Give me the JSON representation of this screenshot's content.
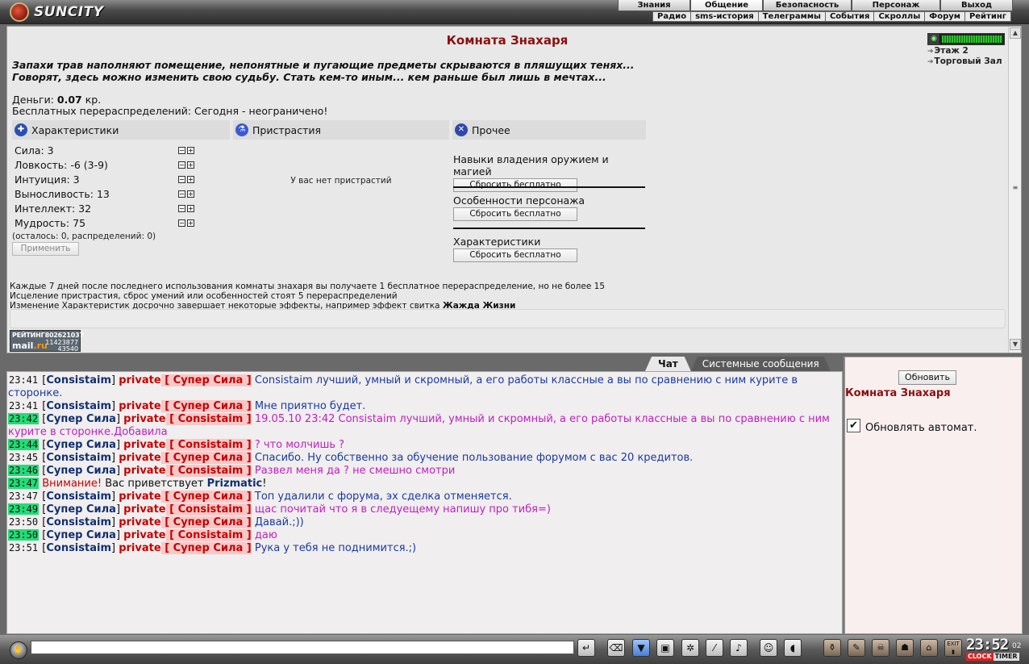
{
  "logo": {
    "text": "SUNCITY"
  },
  "nav_main": [
    "Знания",
    "Общение",
    "Безопасность",
    "Персонаж",
    "Выход"
  ],
  "nav_sub": [
    "Радио",
    "sms-история",
    "Телеграммы",
    "События",
    "Скроллы",
    "Форум",
    "Рейтинг"
  ],
  "room": {
    "title": "Комната Знахаря",
    "description_1": "Запахи трав наполняют помещение, непонятные и пугающие предметы скрываются в пляшущих тенях...",
    "description_2": "Говорят, здесь можно изменить свою судьбу. Стать кем-то иным... кем раньше был лишь в мечтах...",
    "money_label": "Деньги:",
    "money_value": "0.07",
    "money_unit": "кр.",
    "free_redist": "Бесплатных перераспределений: Сегодня - неограничено!",
    "location": {
      "links": [
        "Этаж 2",
        "Торговый Зал"
      ]
    },
    "stats_header": "Характеристики",
    "addict_header": "Пристрастия",
    "other_header": "Прочее",
    "stats": [
      "Сила: 3",
      "Ловкость: -6 (3-9)",
      "Интуиция: 3",
      "Выносливость: 13",
      "Интеллект: 32",
      "Мудрость: 75"
    ],
    "remaining": "(осталось: 0, распределений: 0)",
    "apply_label": "Применить",
    "no_addict": "У вас нет пристрастий",
    "other_blocks": [
      {
        "title": "Навыки владения оружием и магией",
        "button": "Сбросить бесплатно"
      },
      {
        "title": "Особенности персонажа",
        "button": "Сбросить бесплатно"
      },
      {
        "title": "Характеристики",
        "button": "Сбросить бесплатно"
      }
    ],
    "note_1": "Каждые 7 дней после последнего использования комнаты знахаря вы получаете 1 бесплатное перераспределение, но не более 15",
    "note_2": "Исцеление пристрастия, сброс умений или особенностей стоят 5 перераспределений",
    "note_3_prefix": "Изменение Характеристик досрочно завершает некоторые эффекты, например эффект свитка",
    "note_3_bold": "Жажда Жизни",
    "counter": {
      "label": "РЕЙТИНГ",
      "n1": "802621037",
      "n2": "11423877",
      "n3": "43540",
      "brand_a": "mail",
      "brand_b": ".ru"
    }
  },
  "chat": {
    "tabs": [
      "Чат",
      "Системные сообщения"
    ],
    "messages": [
      {
        "time": "23:41",
        "nick": "Consistaim",
        "priv": "Супер Сила",
        "text": "Consistaim лучший, умный и скромный, а его работы классные а вы по сравнению с ним курите в",
        "text2": "сторонке."
      },
      {
        "time": "23:41",
        "nick": "Consistaim",
        "priv": "Супер Сила",
        "text": "Мне приятно будет."
      },
      {
        "time": "23:42",
        "nick": "Супер Сила",
        "priv": "Consistaim",
        "text": "19.05.10 23:42 Consistaim лучший, умный и скромный, а его работы классные а вы по сравнению с ним",
        "text2": "курите в сторонке.Добавила"
      },
      {
        "time": "23:44",
        "nick": "Супер Сила",
        "priv": "Consistaim",
        "text": "? что молчишь ?"
      },
      {
        "time": "23:45",
        "nick": "Consistaim",
        "priv": "Супер Сила",
        "text": "Спасибо. Ну собственно за обучение пользование форумом с вас 20 кредитов."
      },
      {
        "time": "23:46",
        "nick": "Супер Сила",
        "priv": "Consistaim",
        "text": "Развел меня да ? не смешно смотри"
      },
      {
        "time": "23:47",
        "warn": "Внимание!",
        "sys_text": "Вас приветствует",
        "sys_nick": "Prizmatic",
        "sys_end": "!"
      },
      {
        "time": "23:47",
        "nick": "Consistaim",
        "priv": "Супер Сила",
        "text": "Топ удалили с форума, эх сделка отменяется."
      },
      {
        "time": "23:49",
        "nick": "Супер Сила",
        "priv": "Consistaim",
        "text": "щас почитай что я в следуещему напишу про тибя=)"
      },
      {
        "time": "23:50",
        "nick": "Consistaim",
        "priv": "Супер Сила",
        "text": "Давай.;))"
      },
      {
        "time": "23:50",
        "nick": "Супер Сила",
        "priv": "Consistaim",
        "text": "даю"
      },
      {
        "time": "23:51",
        "nick": "Consistaim",
        "priv": "Супер Сила",
        "text": "Рука у тебя не поднимится.;)"
      }
    ],
    "private_word": "private"
  },
  "side": {
    "refresh_label": "Обновить",
    "room_name": "Комната Знахаря",
    "auto_label": "Обновлять автомат.",
    "auto_checked_mark": "✔"
  },
  "bottom": {
    "input_value": "",
    "clock_time": "23:52",
    "clock_sec": "02",
    "clock_label": "CLOCK",
    "timer_label": "TIMER",
    "exit_label": "EXIT",
    "icons": [
      "enter-icon",
      "eraser-icon",
      "filter-icon",
      "save-icon",
      "dance-icon",
      "translit-icon",
      "music-icon",
      "smiley-icon",
      "speaker-icon"
    ],
    "right_icons": [
      "potion-icon",
      "scroll-icon",
      "skull-icon",
      "mask-icon",
      "lock-icon",
      "exit-icon"
    ]
  }
}
